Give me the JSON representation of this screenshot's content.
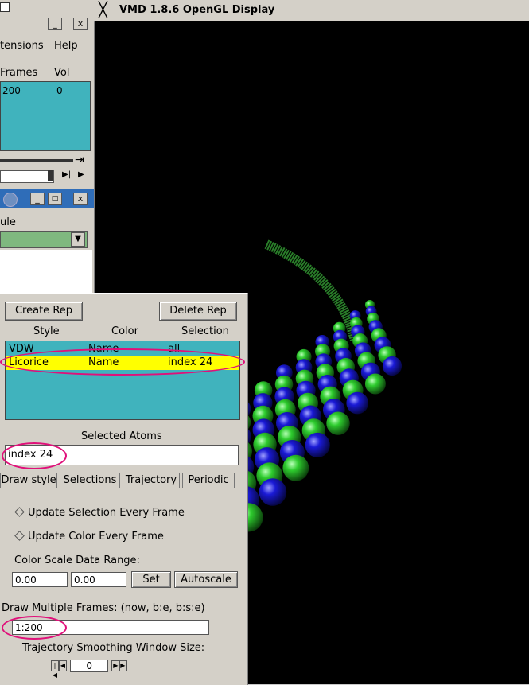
{
  "main_window": {
    "menu": {
      "extensions": "tensions",
      "help": "Help"
    },
    "columns": {
      "frames": "Frames",
      "vol": "Vol"
    },
    "row": {
      "frames": "200",
      "vol": "0"
    },
    "minimize": "_",
    "close": "x"
  },
  "graphics_window": {
    "molecule_label": "ule",
    "minimize": "_",
    "close": "x"
  },
  "display": {
    "title": "VMD 1.8.6 OpenGL Display"
  },
  "reps": {
    "create_rep": "Create Rep",
    "delete_rep": "Delete Rep",
    "headers": {
      "style": "Style",
      "color": "Color",
      "selection": "Selection"
    },
    "rows": [
      {
        "style": "VDW",
        "color": "Name",
        "selection": "all",
        "selected": false
      },
      {
        "style": "Licorice",
        "color": "Name",
        "selection": "index 24",
        "selected": true
      }
    ],
    "selected_atoms_label": "Selected Atoms",
    "selected_atoms_value": "index 24",
    "tabs": [
      "Draw style",
      "Selections",
      "Trajectory",
      "Periodic"
    ],
    "update_selection": "Update Selection Every Frame",
    "update_color": "Update Color Every Frame",
    "color_scale_label": "Color Scale Data Range:",
    "range_min": "0.00",
    "range_max": "0.00",
    "set": "Set",
    "autoscale": "Autoscale",
    "draw_multiple_label": "Draw Multiple Frames: (now, b:e, b:s:e)",
    "draw_multiple_value": "1:200",
    "smoothing_label": "Trajectory Smoothing Window Size:",
    "smoothing_value": "0"
  },
  "colors": {
    "highlight": "#ffff00",
    "list_bg": "#40b3bd",
    "annotation": "#e0107a",
    "atom_green": "#2ecc2e",
    "atom_blue": "#1a1ad6"
  }
}
